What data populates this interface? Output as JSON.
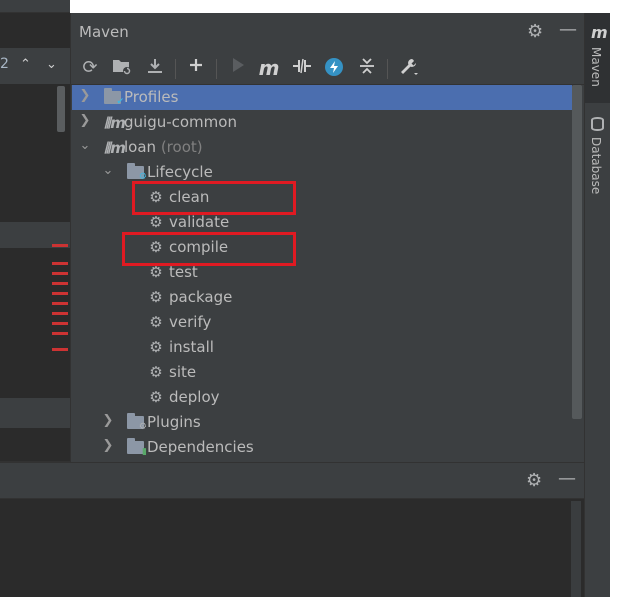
{
  "editor": {
    "line_number": "2",
    "nav_up_glyph": "⌃",
    "nav_down_glyph": "⌄"
  },
  "maven": {
    "title": "Maven",
    "header_icons": [
      "gear-icon",
      "minimize-icon"
    ],
    "toolbar_icons": [
      "reload-icon",
      "generate-sources-icon",
      "download-icon",
      "add-icon",
      "run-icon",
      "maven-goal-icon",
      "toggle-offline-icon",
      "skip-tests-icon",
      "collapse-all-icon",
      "settings-wrench-icon"
    ],
    "tree": [
      {
        "label": "Profiles",
        "sub": "",
        "selected": true,
        "expanded": false
      },
      {
        "label": "guigu-common",
        "sub": "",
        "expanded": false
      },
      {
        "label": "loan",
        "sub": "(root)",
        "expanded": true
      },
      {
        "label": "Lifecycle",
        "sub": "",
        "expanded": true
      },
      {
        "label": "clean",
        "sub": "",
        "highlighted": true
      },
      {
        "label": "validate",
        "sub": ""
      },
      {
        "label": "compile",
        "sub": "",
        "highlighted": true
      },
      {
        "label": "test",
        "sub": ""
      },
      {
        "label": "package",
        "sub": ""
      },
      {
        "label": "verify",
        "sub": ""
      },
      {
        "label": "install",
        "sub": ""
      },
      {
        "label": "site",
        "sub": ""
      },
      {
        "label": "deploy",
        "sub": ""
      },
      {
        "label": "Plugins",
        "sub": "",
        "expanded": false
      },
      {
        "label": "Dependencies",
        "sub": "",
        "expanded": false
      }
    ]
  },
  "bottom_panel": {
    "header_icons": [
      "gear-icon",
      "minimize-icon"
    ]
  },
  "tool_strip": {
    "tabs": [
      {
        "label": "Maven",
        "active": true
      },
      {
        "label": "Database",
        "active": false
      }
    ]
  },
  "colors": {
    "panel_bg": "#3c3f41",
    "editor_bg": "#2b2b2b",
    "selection": "#4b6eaf",
    "highlight_box": "#e01a22",
    "accent_blue": "#40b6e0"
  }
}
